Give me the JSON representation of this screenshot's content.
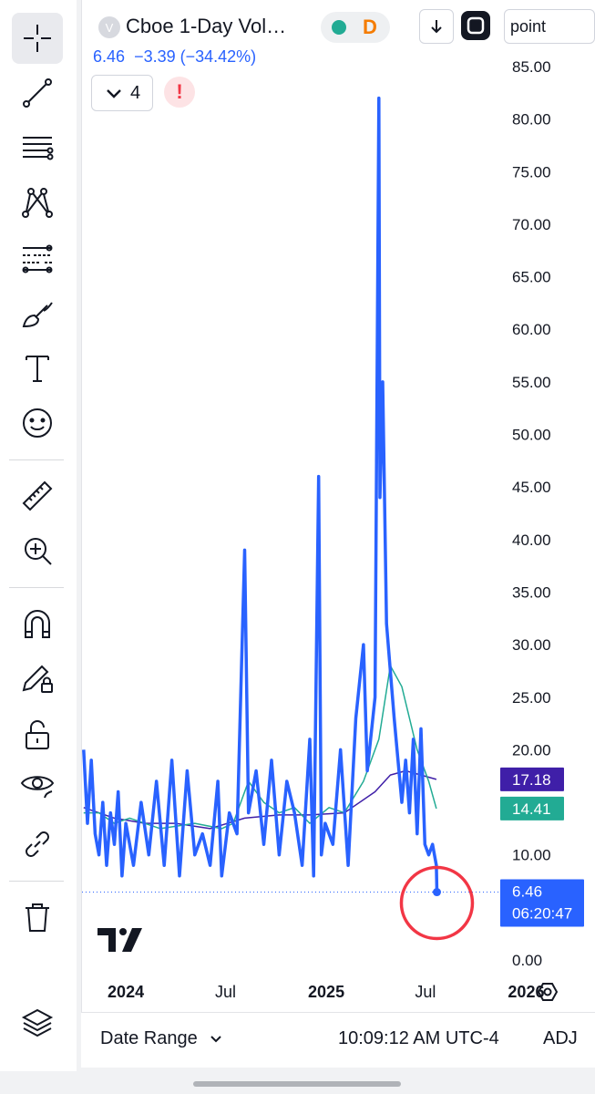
{
  "header": {
    "symbol_icon": "V",
    "title": "Cboe 1-Day Vol…",
    "interval_badge": "D",
    "scale_mode_button": "point"
  },
  "quote": {
    "last": "6.46",
    "change": "−3.39 (−34.42%)"
  },
  "indicators": {
    "collapse_count": "4",
    "warning_glyph": "!"
  },
  "footer": {
    "date_range": "Date Range",
    "clock": "10:09:12 AM UTC-4",
    "adj": "ADJ"
  },
  "icons": [
    "crosshair-icon",
    "trend-line-icon",
    "fib-levels-icon",
    "pattern-icon",
    "forecast-icon",
    "brush-icon",
    "text-icon",
    "emoji-icon",
    "ruler-icon",
    "zoom-in-icon",
    "magnet-icon",
    "lock-drawing-icon",
    "unlock-icon",
    "eye-icon",
    "link-icon",
    "trash-icon",
    "layers-icon",
    "settings-icon"
  ],
  "colors": {
    "price_line": "#2962ff",
    "ma_fast": "#22ab94",
    "ma_slow": "#3f1fa8",
    "highlight_circle": "#f23645",
    "badge_text": "#ffffff"
  },
  "chart_data": {
    "type": "line",
    "ylim": [
      0,
      85
    ],
    "yticks": [
      "85.00",
      "80.00",
      "75.00",
      "70.00",
      "65.00",
      "60.00",
      "55.00",
      "50.00",
      "45.00",
      "40.00",
      "35.00",
      "30.00",
      "25.00",
      "20.00",
      "15.00",
      "10.00",
      "5.00",
      "0.00"
    ],
    "yticks_values": [
      85,
      80,
      75,
      70,
      65,
      60,
      55,
      50,
      45,
      40,
      35,
      30,
      25,
      20,
      15,
      10,
      5,
      0
    ],
    "xlim": [
      "2023-10-13",
      "2025-11-13"
    ],
    "xticks": [
      {
        "label": "2024",
        "date": "2024-01-01",
        "bold": true
      },
      {
        "label": "Jul",
        "date": "2024-07-01",
        "bold": false
      },
      {
        "label": "2025",
        "date": "2025-01-01",
        "bold": true
      },
      {
        "label": "Jul",
        "date": "2025-07-01",
        "bold": false
      },
      {
        "label": "2026",
        "date": "2026-01-01",
        "bold": true
      }
    ],
    "series": [
      {
        "values": [
          [
            "2023-10-16",
            20
          ],
          [
            "2023-10-23",
            13
          ],
          [
            "2023-10-30",
            19
          ],
          [
            "2023-11-06",
            12
          ],
          [
            "2023-11-13",
            10
          ],
          [
            "2023-11-20",
            15
          ],
          [
            "2023-11-27",
            9
          ],
          [
            "2023-12-04",
            14
          ],
          [
            "2023-12-11",
            11
          ],
          [
            "2023-12-18",
            16
          ],
          [
            "2023-12-25",
            8
          ],
          [
            "2024-01-01",
            13
          ],
          [
            "2024-01-15",
            9
          ],
          [
            "2024-01-29",
            15
          ],
          [
            "2024-02-12",
            10
          ],
          [
            "2024-02-26",
            17
          ],
          [
            "2024-03-11",
            9
          ],
          [
            "2024-03-25",
            19
          ],
          [
            "2024-04-08",
            8
          ],
          [
            "2024-04-22",
            18
          ],
          [
            "2024-05-06",
            10
          ],
          [
            "2024-05-20",
            12
          ],
          [
            "2024-06-03",
            9
          ],
          [
            "2024-06-17",
            17
          ],
          [
            "2024-06-24",
            8
          ],
          [
            "2024-07-08",
            14
          ],
          [
            "2024-07-22",
            12
          ],
          [
            "2024-08-05",
            39
          ],
          [
            "2024-08-12",
            14
          ],
          [
            "2024-08-26",
            18
          ],
          [
            "2024-09-09",
            11
          ],
          [
            "2024-09-23",
            19
          ],
          [
            "2024-10-07",
            10
          ],
          [
            "2024-10-21",
            17
          ],
          [
            "2024-11-04",
            14
          ],
          [
            "2024-11-18",
            9
          ],
          [
            "2024-12-02",
            21
          ],
          [
            "2024-12-09",
            8
          ],
          [
            "2024-12-18",
            46
          ],
          [
            "2024-12-23",
            10
          ],
          [
            "2024-12-30",
            13
          ],
          [
            "2025-01-13",
            11
          ],
          [
            "2025-01-27",
            20
          ],
          [
            "2025-02-10",
            9
          ],
          [
            "2025-02-24",
            23
          ],
          [
            "2025-03-10",
            30
          ],
          [
            "2025-03-17",
            18
          ],
          [
            "2025-03-31",
            25
          ],
          [
            "2025-04-07",
            82
          ],
          [
            "2025-04-09",
            44
          ],
          [
            "2025-04-14",
            55
          ],
          [
            "2025-04-21",
            32
          ],
          [
            "2025-05-05",
            23
          ],
          [
            "2025-05-19",
            15
          ],
          [
            "2025-05-26",
            19
          ],
          [
            "2025-06-02",
            14
          ],
          [
            "2025-06-09",
            21
          ],
          [
            "2025-06-16",
            12
          ],
          [
            "2025-06-23",
            22
          ],
          [
            "2025-06-30",
            11
          ],
          [
            "2025-07-07",
            10
          ],
          [
            "2025-07-14",
            11
          ],
          [
            "2025-07-21",
            9
          ],
          [
            "2025-07-22",
            6.46
          ]
        ]
      },
      {
        "values": [
          [
            "2023-10-16",
            14
          ],
          [
            "2023-11-13",
            14
          ],
          [
            "2023-12-11",
            13
          ],
          [
            "2024-01-08",
            13.5
          ],
          [
            "2024-03-04",
            12.5
          ],
          [
            "2024-05-06",
            13
          ],
          [
            "2024-06-24",
            12.5
          ],
          [
            "2024-07-15",
            13
          ],
          [
            "2024-08-12",
            17
          ],
          [
            "2024-09-09",
            15
          ],
          [
            "2024-10-07",
            14
          ],
          [
            "2024-11-04",
            14.5
          ],
          [
            "2024-12-02",
            13
          ],
          [
            "2025-01-06",
            14.5
          ],
          [
            "2025-02-03",
            14
          ],
          [
            "2025-03-10",
            17
          ],
          [
            "2025-04-07",
            21
          ],
          [
            "2025-04-28",
            28
          ],
          [
            "2025-05-19",
            26
          ],
          [
            "2025-06-16",
            20
          ],
          [
            "2025-07-07",
            17
          ],
          [
            "2025-07-21",
            14.41
          ]
        ]
      },
      {
        "values": [
          [
            "2023-10-16",
            14.5
          ],
          [
            "2023-12-11",
            13.5
          ],
          [
            "2024-02-05",
            13
          ],
          [
            "2024-04-01",
            13
          ],
          [
            "2024-06-03",
            12.5
          ],
          [
            "2024-08-05",
            13.5
          ],
          [
            "2024-10-07",
            13.8
          ],
          [
            "2024-12-02",
            13.8
          ],
          [
            "2025-02-03",
            14
          ],
          [
            "2025-03-31",
            16
          ],
          [
            "2025-04-28",
            17.6
          ],
          [
            "2025-05-26",
            18
          ],
          [
            "2025-06-23",
            17.6
          ],
          [
            "2025-07-21",
            17.18
          ]
        ]
      }
    ],
    "price_labels": [
      {
        "series": 2,
        "value": 17.18,
        "text": "17.18"
      },
      {
        "series": 1,
        "value": 14.41,
        "text": "14.41"
      },
      {
        "series": 0,
        "value": 6.46,
        "text": "6.46",
        "sub": "06:20:47"
      }
    ]
  }
}
